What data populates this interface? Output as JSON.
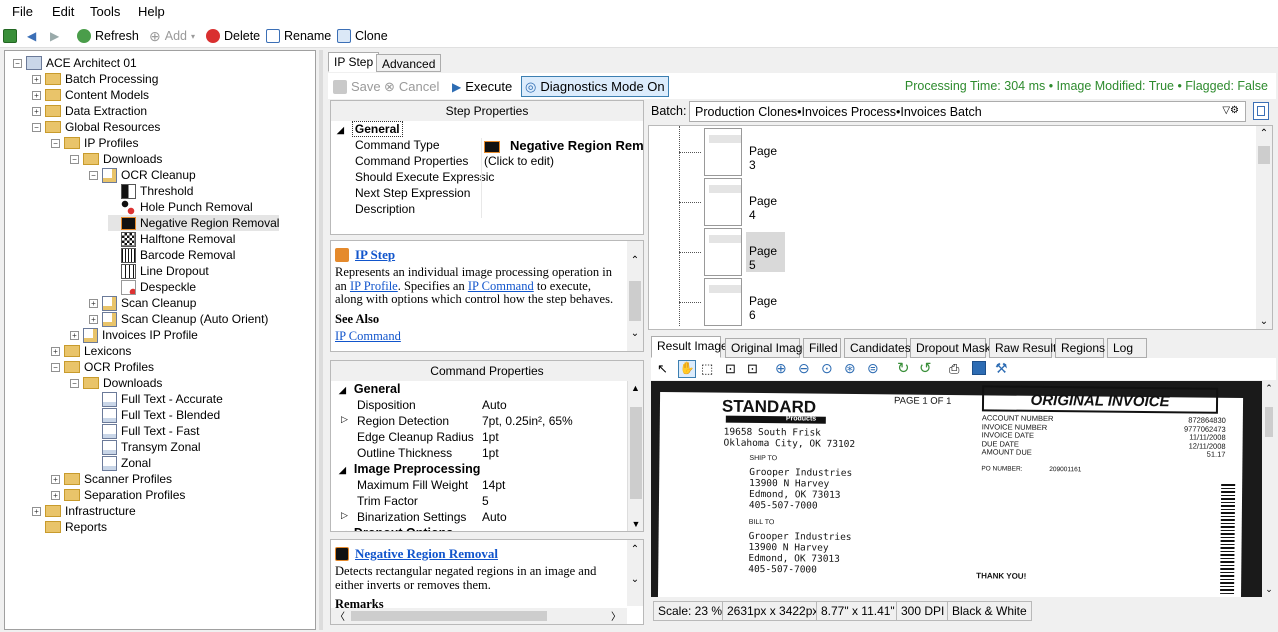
{
  "menu": [
    "File",
    "Edit",
    "Tools",
    "Help"
  ],
  "toolbar": {
    "refresh": "Refresh",
    "add": "Add",
    "delete": "Delete",
    "rename": "Rename",
    "clone": "Clone"
  },
  "tree": [
    {
      "label": "ACE Architect 01",
      "depth": 0,
      "icon": "server-icon"
    },
    {
      "label": "Batch Processing",
      "depth": 1,
      "icon": "folder-icon"
    },
    {
      "label": "Content Models",
      "depth": 1,
      "icon": "folder-icon"
    },
    {
      "label": "Data Extraction",
      "depth": 1,
      "icon": "folder-icon"
    },
    {
      "label": "Global Resources",
      "depth": 1,
      "icon": "folder-icon"
    },
    {
      "label": "IP Profiles",
      "depth": 2,
      "icon": "folder-icon"
    },
    {
      "label": "Downloads",
      "depth": 3,
      "icon": "folder-icon"
    },
    {
      "label": "OCR Cleanup",
      "depth": 4,
      "icon": "profile-icon"
    },
    {
      "label": "Threshold",
      "depth": 5,
      "icon": "threshold-icon"
    },
    {
      "label": "Hole Punch Removal",
      "depth": 5,
      "icon": "hole-punch-icon"
    },
    {
      "label": "Negative Region Removal",
      "depth": 5,
      "icon": "negative-region-icon"
    },
    {
      "label": "Halftone Removal",
      "depth": 5,
      "icon": "halftone-icon"
    },
    {
      "label": "Barcode Removal",
      "depth": 5,
      "icon": "barcode-icon"
    },
    {
      "label": "Line Dropout",
      "depth": 5,
      "icon": "line-dropout-icon"
    },
    {
      "label": "Despeckle",
      "depth": 5,
      "icon": "despeckle-icon"
    },
    {
      "label": "Scan Cleanup",
      "depth": 4,
      "icon": "profile-icon"
    },
    {
      "label": "Scan Cleanup (Auto Orient)",
      "depth": 4,
      "icon": "profile-icon"
    },
    {
      "label": "Invoices IP Profile",
      "depth": 3,
      "icon": "profile-icon"
    },
    {
      "label": "Lexicons",
      "depth": 2,
      "icon": "folder-icon"
    },
    {
      "label": "OCR Profiles",
      "depth": 2,
      "icon": "folder-icon"
    },
    {
      "label": "Downloads",
      "depth": 3,
      "icon": "folder-icon"
    },
    {
      "label": "Full Text - Accurate",
      "depth": 4,
      "icon": "ocr-profile-icon"
    },
    {
      "label": "Full Text - Blended",
      "depth": 4,
      "icon": "ocr-profile-icon"
    },
    {
      "label": "Full Text - Fast",
      "depth": 4,
      "icon": "ocr-profile-icon"
    },
    {
      "label": "Transym Zonal",
      "depth": 4,
      "icon": "ocr-profile-icon"
    },
    {
      "label": "Zonal",
      "depth": 4,
      "icon": "ocr-profile-icon"
    },
    {
      "label": "Scanner Profiles",
      "depth": 2,
      "icon": "folder-icon"
    },
    {
      "label": "Separation Profiles",
      "depth": 2,
      "icon": "folder-icon"
    },
    {
      "label": "Infrastructure",
      "depth": 1,
      "icon": "folder-icon"
    },
    {
      "label": "Reports",
      "depth": 1,
      "icon": "folder-icon"
    }
  ],
  "tabs": {
    "ip_step": "IP Step",
    "advanced": "Advanced"
  },
  "actions": {
    "save": "Save",
    "cancel": "Cancel",
    "execute": "Execute",
    "diagnostics": "Diagnostics Mode On"
  },
  "status_line": "Processing Time: 304 ms • Image Modified: True • Flagged: False",
  "step_props": {
    "header": "Step Properties",
    "category": "General",
    "rows": [
      {
        "name": "Command Type",
        "value": "Negative Region Remov"
      },
      {
        "name": "Command Properties",
        "value": "(Click to edit)"
      },
      {
        "name": "Should Execute Expressic",
        "value": ""
      },
      {
        "name": "Next Step Expression",
        "value": ""
      },
      {
        "name": "Description",
        "value": ""
      }
    ]
  },
  "help1": {
    "title": "IP Step",
    "text1": "Represents an individual image processing operation in an",
    "link1": "IP Profile",
    "text2": ". Specifies an",
    "link2": "IP Command",
    "text3": "to execute, along with options which control how the step behaves.",
    "see_also": "See Also",
    "see_link": "IP Command"
  },
  "cmd_props": {
    "header": "Command Properties",
    "rows": [
      {
        "kind": "cat",
        "name": "General"
      },
      {
        "kind": "row",
        "name": "Disposition",
        "value": "Auto"
      },
      {
        "kind": "row",
        "name": "Region Detection",
        "value": "7pt, 0.25in², 65%",
        "expand": true
      },
      {
        "kind": "row",
        "name": "Edge Cleanup Radius",
        "value": "1pt"
      },
      {
        "kind": "row",
        "name": "Outline Thickness",
        "value": "1pt"
      },
      {
        "kind": "cat",
        "name": "Image Preprocessing"
      },
      {
        "kind": "row",
        "name": "Maximum Fill Weight",
        "value": "14pt"
      },
      {
        "kind": "row",
        "name": "Trim Factor",
        "value": "5"
      },
      {
        "kind": "row",
        "name": "Binarization Settings",
        "value": "Auto",
        "expand": true
      },
      {
        "kind": "cat",
        "name": "Dropout Options"
      }
    ]
  },
  "help2": {
    "title": "Negative Region Removal",
    "text": "Detects rectangular negated regions in an image and either inverts or removes them.",
    "remarks": "Remarks"
  },
  "batch": {
    "label": "Batch:",
    "path": "Production Clones•Invoices Process•Invoices Batch",
    "pages": [
      "Page 3",
      "Page 4",
      "Page 5",
      "Page 6"
    ],
    "selected_page": "Page 5"
  },
  "image_tabs": [
    "Result Image",
    "Original Image",
    "Filled",
    "Candidates",
    "Dropout Mask",
    "Raw Result",
    "Regions",
    "Log"
  ],
  "invoice": {
    "company": "STANDARD",
    "products": "Products",
    "page": "PAGE 1 OF 1",
    "title": "ORIGINAL INVOICE",
    "addr1": "19658 South Frisk",
    "addr2": "Oklahoma City, OK 73102",
    "labels": [
      "ACCOUNT NUMBER",
      "INVOICE NUMBER",
      "INVOICE DATE",
      "DUE DATE",
      "AMOUNT DUE"
    ],
    "values": [
      "872864830",
      "9777062473",
      "11/11/2008",
      "12/11/2008",
      "51.17"
    ],
    "ship_to": "SHIP TO",
    "ship": [
      "Grooper Industries",
      "13900 N Harvey",
      "Edmond, OK 73013",
      "405-507-7000"
    ],
    "po": "PO NUMBER:",
    "po_value": "209001161",
    "bill_to": "BILL TO",
    "bill": [
      "Grooper Industries",
      "13900 N Harvey",
      "Edmond, OK 73013",
      "405-507-7000"
    ],
    "footer": "THANK YOU!"
  },
  "image_status": [
    "Scale: 23 %",
    "2631px x 3422px",
    "8.77\" x 11.41\"",
    "300 DPI",
    "Black & White"
  ],
  "colors": {
    "status_green": "#2e8b2e",
    "link": "#1155cc",
    "selection": "#e5e5e5"
  }
}
